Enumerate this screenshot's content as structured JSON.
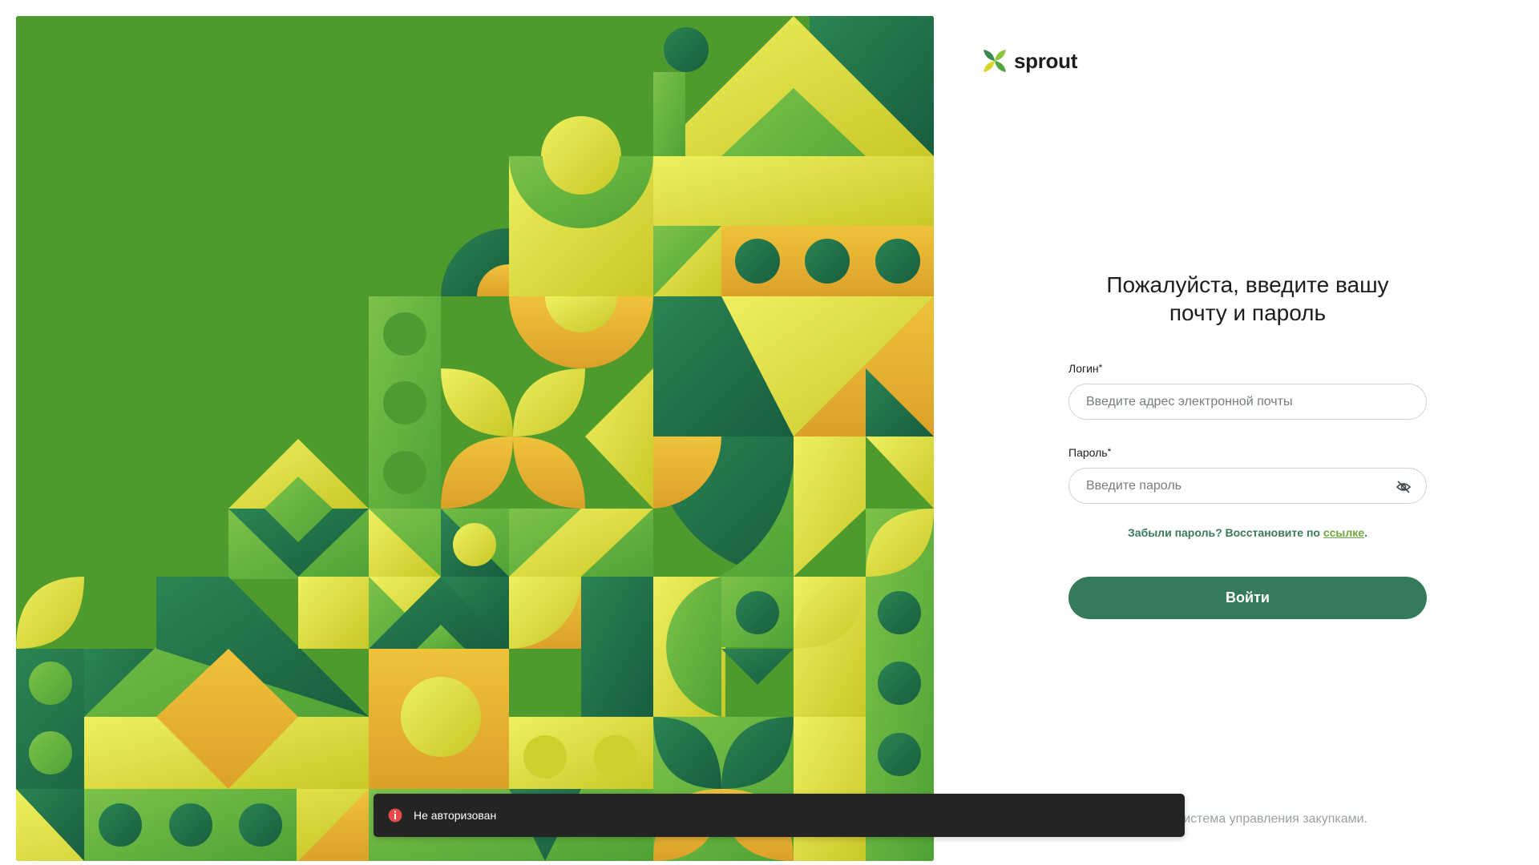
{
  "brand": {
    "name": "sprout",
    "logo_icon": "sprout-logo-icon"
  },
  "login_form": {
    "title_line1": "Пожалуйста, введите вашу",
    "title_line2": "почту и пароль",
    "login_label": "Логин",
    "login_placeholder": "Введите адрес электронной почты",
    "login_value": "",
    "password_label": "Пароль",
    "password_placeholder": "Введите пароль",
    "password_value": "",
    "password_toggle_icon": "eye-off-icon",
    "required_mark": "*",
    "forgot_text": "Забыли пароль? Восстановите по ",
    "forgot_link": "ссылке",
    "forgot_end": ".",
    "submit_label": "Войти"
  },
  "footer": {
    "text": "СПРАУТ. Система управления закупками."
  },
  "toast": {
    "icon": "error-info-icon",
    "message": "Не авторизован"
  },
  "colors": {
    "primary_button": "#357b59",
    "link": "#6da73f",
    "forgot_text": "#3a7a5a",
    "toast_bg": "#242424",
    "toast_icon": "#e34b4b",
    "art_green": "#4e9a2c",
    "art_dark": "#1f6b4a",
    "art_yellow": "#d8dc33",
    "art_orange": "#e6ae2a"
  }
}
